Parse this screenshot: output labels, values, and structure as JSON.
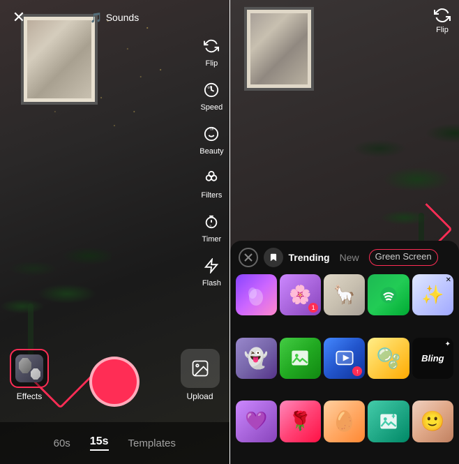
{
  "left_panel": {
    "sounds_label": "Sounds",
    "close_icon": "✕",
    "toolbar": [
      {
        "id": "flip",
        "label": "Flip",
        "icon": "⟳"
      },
      {
        "id": "speed",
        "label": "Speed",
        "icon": "⏱"
      },
      {
        "id": "beauty",
        "label": "Beauty",
        "icon": "✨"
      },
      {
        "id": "filters",
        "label": "Filters",
        "icon": "⚙"
      },
      {
        "id": "timer",
        "label": "Timer",
        "icon": "⏱"
      },
      {
        "id": "flash",
        "label": "Flash",
        "icon": "⚡"
      }
    ],
    "effects_label": "Effects",
    "upload_label": "Upload",
    "time_options": [
      {
        "value": "60s",
        "active": false
      },
      {
        "value": "15s",
        "active": true
      },
      {
        "value": "Templates",
        "active": false
      }
    ]
  },
  "right_panel": {
    "flip_label": "Flip",
    "effects_panel": {
      "tabs": [
        {
          "id": "trending",
          "label": "Trending",
          "active": true
        },
        {
          "id": "new",
          "label": "New",
          "active": false
        },
        {
          "id": "green_screen",
          "label": "Green Screen",
          "highlighted": true
        }
      ],
      "effects": [
        {
          "id": 1,
          "type": "gradient_purple",
          "badge": null
        },
        {
          "id": 2,
          "type": "gradient_lavender",
          "badge": "1"
        },
        {
          "id": 3,
          "type": "llama",
          "badge": null
        },
        {
          "id": 4,
          "type": "spotify_green",
          "badge": null
        },
        {
          "id": 5,
          "type": "sparkle_cross",
          "badge": null
        },
        {
          "id": 6,
          "type": "ghost_purple",
          "badge": null
        },
        {
          "id": 7,
          "type": "photo_green",
          "badge": null
        },
        {
          "id": 8,
          "type": "video_blue",
          "badge": null
        },
        {
          "id": 9,
          "type": "bubble_yellow",
          "badge": null
        },
        {
          "id": 10,
          "type": "bling_text",
          "label": "Bling",
          "badge": null
        },
        {
          "id": 11,
          "type": "gradient_violet",
          "badge": null
        },
        {
          "id": 12,
          "type": "gradient_pink",
          "badge": null
        },
        {
          "id": 13,
          "type": "gradient_orange",
          "badge": null
        },
        {
          "id": 14,
          "type": "gradient_teal",
          "badge": null
        },
        {
          "id": 15,
          "type": "gradient_peach",
          "badge": null
        }
      ]
    }
  },
  "colors": {
    "accent": "#ff2d55",
    "bg_dark": "#111111",
    "panel_bg": "#1a1a1a"
  }
}
